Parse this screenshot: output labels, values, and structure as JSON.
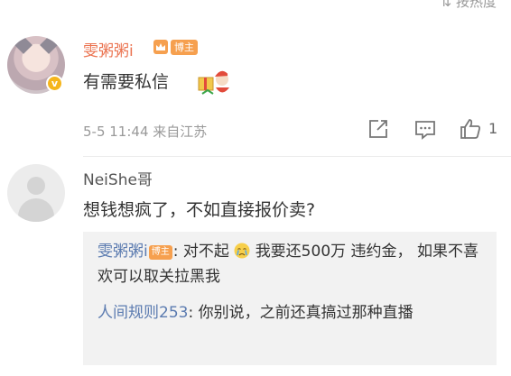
{
  "header": {
    "sort_label": "按热度"
  },
  "comments": [
    {
      "username": "雯粥粥i",
      "badge": "博主",
      "text": "有需要私信",
      "time": "5-5 11:44",
      "location": "来自江苏",
      "like_count": "1"
    },
    {
      "username": "NeiShe哥",
      "text": "想钱想疯了，不如直接报价卖?",
      "replies": [
        {
          "name": "雯粥粥i",
          "badge": "博主",
          "text_before": "对不起",
          "text_after": "我要还500万 违约金， 如果不喜欢可以取关拉黑我"
        },
        {
          "name": "人间规则253",
          "text": "你别说，之前还真搞过那种直播"
        }
      ]
    }
  ],
  "colors": {
    "username": "#eb7350",
    "link": "#5b7bb0",
    "badge": "#f6a04f",
    "meta": "#999999"
  },
  "icons": [
    "crown-icon",
    "sticker-icon",
    "share-icon",
    "comment-icon",
    "like-icon",
    "cry-emoji-icon",
    "verified-badge-icon"
  ]
}
